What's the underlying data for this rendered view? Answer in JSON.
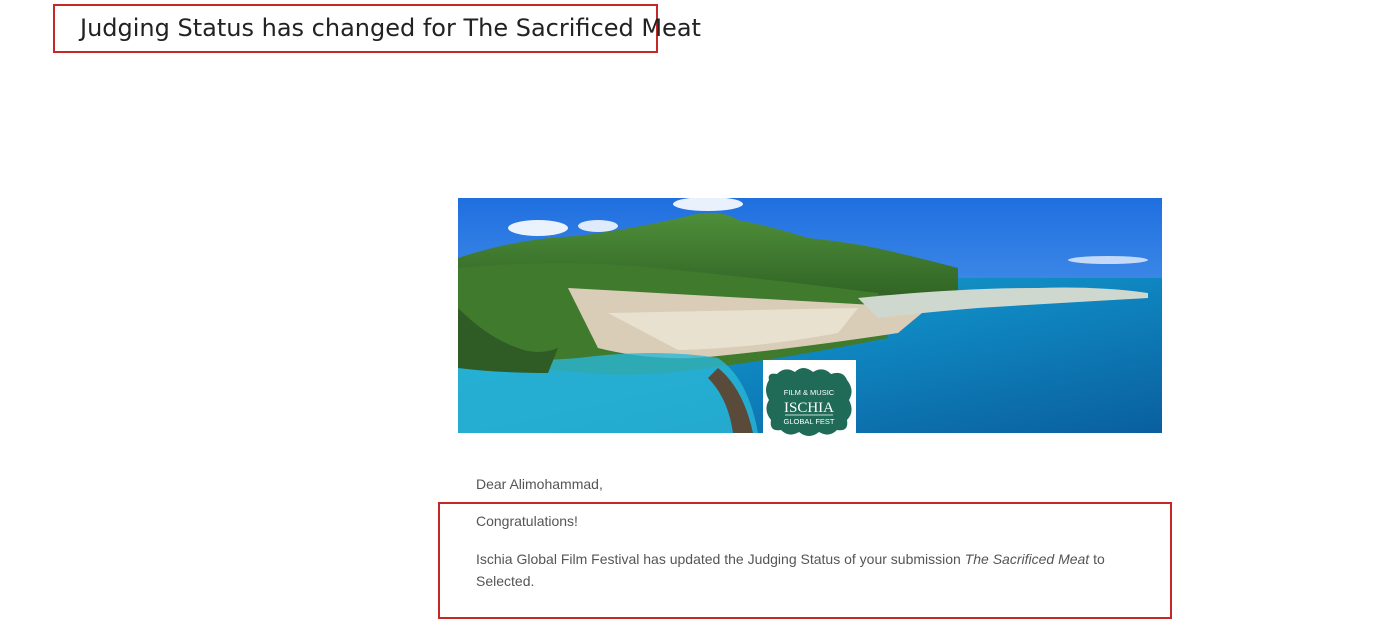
{
  "email": {
    "subject": "Judging Status has changed for The Sacrificed Meat",
    "greeting": "Dear Alimohammad,",
    "congrats": "Congratulations!",
    "body_prefix": "Ischia Global Film Festival has updated the Judging Status of your submission ",
    "film_title": "The Sacrificed Meat",
    "body_suffix": " to Selected."
  },
  "banner": {
    "image_name": "ischia-coastline-photo",
    "logo": {
      "line1": "FILM & MUSIC",
      "line2": "ISCHIA",
      "line3": "GLOBAL FEST",
      "color": "#1f6b57"
    }
  },
  "colors": {
    "highlight_border": "#c62828",
    "text": "#555555",
    "subject_text": "#222222"
  }
}
